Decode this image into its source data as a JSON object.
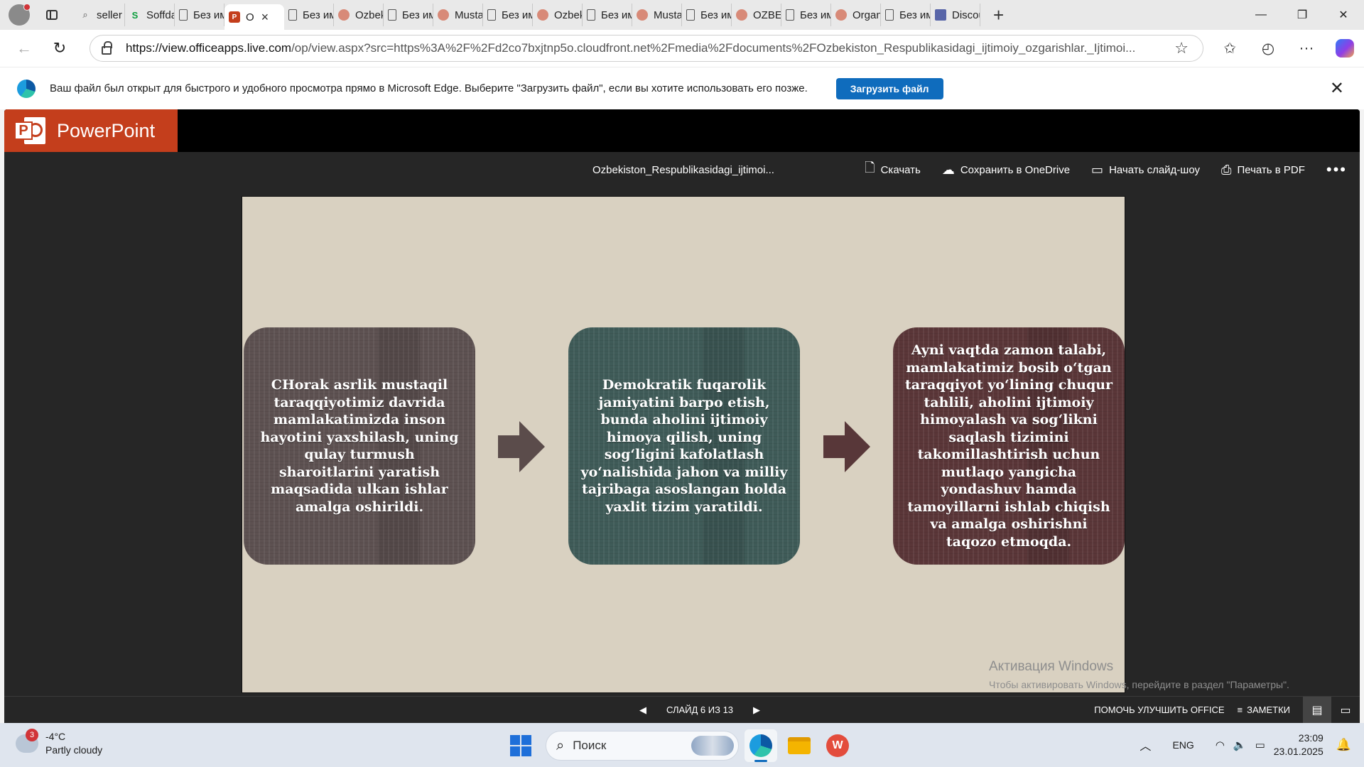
{
  "browser": {
    "tabs": [
      {
        "label": "seller s",
        "favicon": "search-icon"
      },
      {
        "label": "Soffda",
        "favicon": "soffda-icon"
      },
      {
        "label": "Без им",
        "favicon": "document-icon"
      },
      {
        "label": "O",
        "favicon": "powerpoint-icon",
        "active": true
      },
      {
        "label": "Без им",
        "favicon": "document-icon"
      },
      {
        "label": "Ozbek",
        "favicon": "presentation-icon"
      },
      {
        "label": "Без им",
        "favicon": "document-icon"
      },
      {
        "label": "Musta",
        "favicon": "presentation-icon"
      },
      {
        "label": "Без им",
        "favicon": "document-icon"
      },
      {
        "label": "Ozbek",
        "favicon": "presentation-icon"
      },
      {
        "label": "Без им",
        "favicon": "document-icon"
      },
      {
        "label": "Musta",
        "favicon": "presentation-icon"
      },
      {
        "label": "Без им",
        "favicon": "document-icon"
      },
      {
        "label": "OZBEK",
        "favicon": "presentation-icon"
      },
      {
        "label": "Без им",
        "favicon": "document-icon"
      },
      {
        "label": "Organ",
        "favicon": "presentation-icon"
      },
      {
        "label": "Без им",
        "favicon": "document-icon"
      },
      {
        "label": "Discou",
        "favicon": "word-icon"
      }
    ],
    "url_host": "https://view.officeapps.live.com",
    "url_rest": "/op/view.aspx?src=https%3A%2F%2Fd2co7bxjtnp5o.cloudfront.net%2Fmedia%2Fdocuments%2FOzbekiston_Respublikasidagi_ijtimoiy_ozgarishlar._Ijtimoi..."
  },
  "infobar": {
    "message": "Ваш файл был открыт для быстрого и удобного просмотра прямо в Microsoft Edge. Выберите \"Загрузить файл\", если вы хотите использовать его позже.",
    "button": "Загрузить файл"
  },
  "viewer": {
    "app_name": "PowerPoint",
    "doc_name": "Ozbekiston_Respublikasidagi_ijtimoi...",
    "actions": {
      "download": "Скачать",
      "onedrive": "Сохранить в OneDrive",
      "slideshow": "Начать слайд-шоу",
      "print": "Печать в PDF"
    },
    "slide": {
      "cards": [
        {
          "text": "CHorak asrlik mustaqil taraqqiyotimiz davrida mamlakatimizda inson hayotini yaxshilash, uning qulay turmush sharoitlarini yaratish maqsadida ulkan ishlar amalga oshirildi.",
          "color": "#5d5151"
        },
        {
          "text": "Demokratik fuqarolik jamiyatini barpo etish, bunda aholini ijtimoiy himoya qilish, uning sog‘ligini kafolatlash yo‘nalishida jahon va milliy tajribaga asoslangan holda yaxlit tizim yaratildi.",
          "color": "#3f5b58"
        },
        {
          "text": "Ayni vaqtda zamon talabi, mamlakatimiz bosib o‘tgan taraqqiyot yo‘lining chuqur tahlili, aholini ijtimoiy himoyalash va sog‘likni saqlash tizimini takomillashtirish uchun mutlaqo yangicha yondashuv hamda tamoyillarni ishlab chiqish va amalga oshirishni taqozo etmoqda.",
          "color": "#5a3638"
        }
      ],
      "background": "#d9d1c1"
    },
    "watermark": {
      "line1": "Активация Windows",
      "line2": "Чтобы активировать Windows, перейдите в раздел \"Параметры\"."
    },
    "status": {
      "slide_counter": "СЛАЙД 6 ИЗ 13",
      "help": "ПОМОЧЬ УЛУЧШИТЬ OFFICE",
      "notes": "ЗАМЕТКИ"
    }
  },
  "taskbar": {
    "weather_badge": "3",
    "temperature": "-4°C",
    "condition": "Partly cloudy",
    "search_placeholder": "Поиск",
    "lang": "ENG",
    "time": "23:09",
    "date": "23.01.2025"
  }
}
